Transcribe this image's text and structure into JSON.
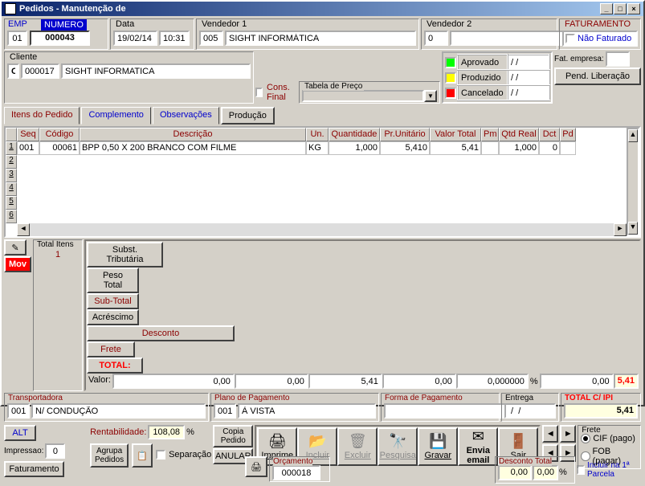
{
  "window": {
    "title": "Pedidos - Manutenção de"
  },
  "top": {
    "emp_label": "EMP",
    "emp": "01",
    "numero_label": "NUMERO",
    "numero": "000043",
    "data_label": "Data",
    "data": "19/02/14",
    "hora": "10:31",
    "vendedor1_label": "Vendedor 1",
    "v1_code": "005",
    "v1_name": "SIGHT INFORMÁTICA",
    "vendedor2_label": "Vendedor 2",
    "v2_code": "0",
    "fatur_label": "FATURAMENTO",
    "nao_faturado": "Não Faturado"
  },
  "cliente": {
    "label": "Cliente",
    "type": "C",
    "code": "000017",
    "name": "SIGHT INFORMATICA",
    "cons_final": "Cons. Final",
    "tabela_preco": "Tabela de Preço",
    "fat_empresa": "Fat. empresa:",
    "pend_liberacao": "Pend. Liberação"
  },
  "status": {
    "aprovado": "Aprovado",
    "aprovado_date": " /  /",
    "produzido": "Produzido",
    "produzido_date": " /  /",
    "cancelado": "Cancelado",
    "cancelado_date": " /  /"
  },
  "tabs": {
    "itens": "Itens do Pedido",
    "complemento": "Complemento",
    "observacoes": "Observações",
    "producao": "Produção"
  },
  "grid": {
    "headers": {
      "seq": "Seq",
      "codigo": "Código",
      "descricao": "Descrição",
      "un": "Un.",
      "quantidade": "Quantidade",
      "pr_unit": "Pr.Unitário",
      "valor_total": "Valor Total",
      "pm": "Pm",
      "qtd_real": "Qtd Real",
      "dct": "Dct",
      "pd": "Pd"
    },
    "row1": {
      "seq": "001",
      "codigo": "00061",
      "descricao": "BPP 0,50 X 200    BRANCO COM FILME",
      "un": "KG",
      "quantidade": "1,000",
      "pr_unit": "5,410",
      "valor_total": "5,41",
      "pm": "",
      "qtd_real": "1,000",
      "dct": "0",
      "pd": ""
    }
  },
  "totals": {
    "mov": "Mov",
    "total_itens_label": "Total Itens",
    "total_itens": "1",
    "subst_trib": "Subst. Tributária",
    "peso_total": "Peso Total",
    "sub_total": "Sub-Total",
    "acrescimo": "Acréscimo",
    "desconto": "Desconto",
    "frete": "Frete",
    "total": "TOTAL:",
    "valor_label": "Valor:",
    "valor": "0,00",
    "peso_val": "0,00",
    "sub_val": "5,41",
    "acr_val": "0,00",
    "desc_val": "0,000000",
    "desc_pct": "%",
    "frete_val": "0,00",
    "total_val": "5,41"
  },
  "transport": {
    "label": "Transportadora",
    "code": "001",
    "name": "N/ CONDUÇÃO",
    "plano_label": "Plano de Pagamento",
    "plano_code": "001",
    "plano_name": "À VISTA",
    "forma_label": "Forma de Pagamento",
    "entrega_label": "Entrega",
    "entrega": " /  /",
    "total_ipi_label": "TOTAL C/ IPI",
    "total_ipi": "5,41"
  },
  "toolbar": {
    "alt": "ALT",
    "rentabilidade": "Rentabilidade:",
    "rent_val": "108,08",
    "rent_pct": "%",
    "impressao": "Impressao:",
    "imp_val": "0",
    "copia": "Copia Pedido",
    "anular": "ANULAR",
    "imprime": "Imprime",
    "incluir": "Incluir",
    "excluir": "Excluir",
    "pesquisa": "Pesquisa",
    "gravar": "Gravar",
    "envia_email": "Envia email",
    "sair": "Sair",
    "faturamento": "Faturamento",
    "agrupa": "Agrupa Pedidos",
    "separacao": "Separação",
    "orcamento_label": "Orçamento",
    "orcamento": "000018",
    "desconto_total": "Desconto Total",
    "dt_val": "0,00",
    "dt_pct": "0,00",
    "incluir_parcela": "Incluir na 1ª Parcela",
    "frete_label": "Frete",
    "cif": "CIF (pago)",
    "fob": "FOB (pagar)"
  }
}
